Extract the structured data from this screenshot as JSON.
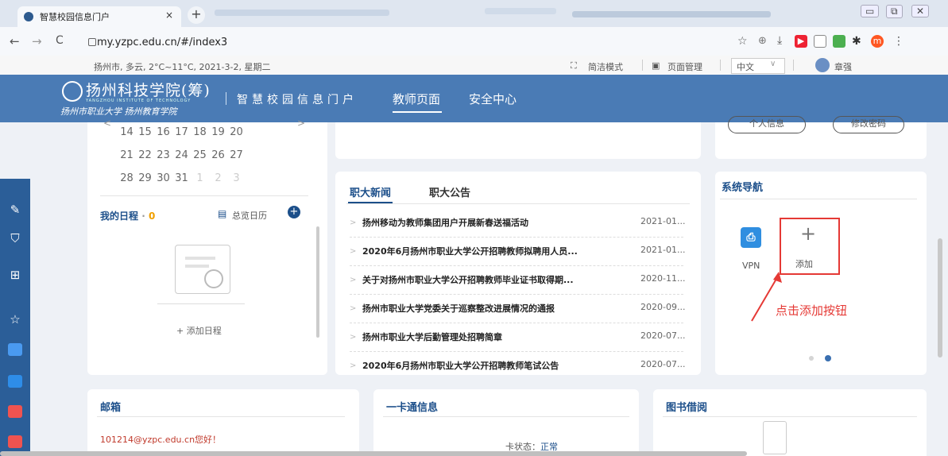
{
  "browser": {
    "tab_title": "智慧校园信息门户",
    "tab_close": "×",
    "new_tab": "+",
    "window_controls": [
      "▭",
      "⧉",
      "✕"
    ],
    "back": "←",
    "forward": "→",
    "reload": "C",
    "url": "my.yzpc.edu.cn/#/index3",
    "ext_avatar": "m"
  },
  "topbar": {
    "weather": "扬州市, 多云, 2°C~11°C, 2021-3-2, 星期二",
    "simple_mode": "简洁模式",
    "page_manage": "页面管理",
    "language": "中文",
    "user_name": "章强"
  },
  "header": {
    "logo_main": "扬州科技学院(筹)",
    "logo_en": "YANGZHOU INSTITUTE OF TECHNOLOGY",
    "logo_sub": "扬州市职业大学 扬州教育学院",
    "portal_title": "智慧校园信息门户",
    "nav": [
      "教师页面",
      "安全中心"
    ]
  },
  "calendar": {
    "rows": [
      [
        "14",
        "15",
        "16",
        "17",
        "18",
        "19",
        "20"
      ],
      [
        "21",
        "22",
        "23",
        "24",
        "25",
        "26",
        "27"
      ],
      [
        "28",
        "29",
        "30",
        "31",
        "1",
        "2",
        "3"
      ]
    ],
    "prev": "<",
    "next": ">"
  },
  "schedule": {
    "title": "我的日程",
    "dot": "·",
    "count": "0",
    "overview": "总览日历",
    "add_label": "+ 添加日程"
  },
  "profile": {
    "personal_info": "个人信息",
    "change_password": "修改密码"
  },
  "news": {
    "tabs": [
      "职大新闻",
      "职大公告"
    ],
    "items": [
      {
        "title": "扬州移动为教师集团用户开展新春送福活动",
        "date": "2021-01..."
      },
      {
        "title": "2020年6月扬州市职业大学公开招聘教师拟聘用人员...",
        "date": "2021-01..."
      },
      {
        "title": "关于对扬州市职业大学公开招聘教师毕业证书取得期...",
        "date": "2020-11..."
      },
      {
        "title": "扬州市职业大学党委关于巡察整改进展情况的通报",
        "date": "2020-09..."
      },
      {
        "title": "扬州市职业大学后勤管理处招聘简章",
        "date": "2020-07..."
      },
      {
        "title": "2020年6月扬州市职业大学公开招聘教师笔试公告",
        "date": "2020-07..."
      }
    ]
  },
  "sysnav": {
    "title": "系统导航",
    "vpn_label": "VPN",
    "add_plus": "+",
    "add_label": "添加",
    "annotation": "点击添加按钮"
  },
  "bottom": {
    "mail_title": "邮箱",
    "mail_greeting": "101214@yzpc.edu.cn您好！",
    "card_title": "一卡通信息",
    "card_status_label": "卡状态：",
    "card_status_value": "正常",
    "library_title": "图书借阅"
  },
  "colors": {
    "header": "#4a7bb5",
    "accent_blue": "#1c4f8a",
    "annotation_red": "#e53935",
    "sidebar": "#2b5e98"
  }
}
